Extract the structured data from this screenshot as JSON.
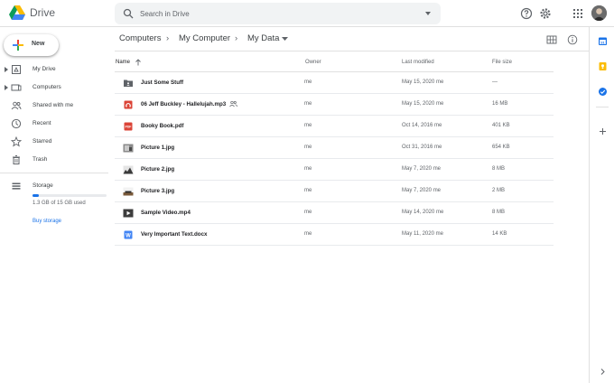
{
  "header": {
    "app_title": "Drive",
    "search_placeholder": "Search in Drive",
    "icons": [
      "help-icon",
      "settings-icon",
      "apps-icon"
    ]
  },
  "sidebar": {
    "new_label": "New",
    "items": [
      {
        "label": "My Drive",
        "icon": "my-drive-icon"
      },
      {
        "label": "Computers",
        "icon": "computers-icon"
      },
      {
        "label": "Shared with me",
        "icon": "shared-icon"
      },
      {
        "label": "Recent",
        "icon": "recent-icon"
      },
      {
        "label": "Starred",
        "icon": "star-icon"
      },
      {
        "label": "Trash",
        "icon": "trash-icon"
      }
    ],
    "storage": {
      "label": "Storage",
      "used_text": "1.3 GB of 15 GB used",
      "used_fraction": 0.087,
      "buy_label": "Buy storage"
    }
  },
  "breadcrumb": [
    "Computers",
    "My Computer",
    "My Data"
  ],
  "table": {
    "headers": {
      "name": "Name",
      "owner": "Owner",
      "modified": "Last modified",
      "size": "File size"
    },
    "rows": [
      {
        "name": "Just Some Stuff",
        "owner": "me",
        "modified": "May 15, 2020 me",
        "size": "—",
        "icon": "folder-icon",
        "shared": false
      },
      {
        "name": "06 Jeff Buckley - Hallelujah.mp3",
        "owner": "me",
        "modified": "May 15, 2020 me",
        "size": "16 MB",
        "icon": "audio-file-icon",
        "shared": true
      },
      {
        "name": "Booky Book.pdf",
        "owner": "me",
        "modified": "Oct 14, 2016 me",
        "size": "401 KB",
        "icon": "pdf-file-icon",
        "shared": false
      },
      {
        "name": "Picture 1.jpg",
        "owner": "me",
        "modified": "Oct 31, 2016 me",
        "size": "654 KB",
        "icon": "image-thumbnail-icon",
        "shared": false
      },
      {
        "name": "Picture 2.jpg",
        "owner": "me",
        "modified": "May 7, 2020 me",
        "size": "8 MB",
        "icon": "image-thumbnail-icon",
        "shared": false
      },
      {
        "name": "Picture 3.jpg",
        "owner": "me",
        "modified": "May 7, 2020 me",
        "size": "2 MB",
        "icon": "image-thumbnail-icon",
        "shared": false
      },
      {
        "name": "Sample Video.mp4",
        "owner": "me",
        "modified": "May 14, 2020 me",
        "size": "8 MB",
        "icon": "video-file-icon",
        "shared": false
      },
      {
        "name": "Very Important Text.docx",
        "owner": "me",
        "modified": "May 11, 2020 me",
        "size": "14 KB",
        "icon": "word-doc-icon",
        "shared": false
      }
    ]
  },
  "colors": {
    "accent": "#1a73e8",
    "pdf_red": "#db4437",
    "doc_blue": "#4285f4"
  }
}
